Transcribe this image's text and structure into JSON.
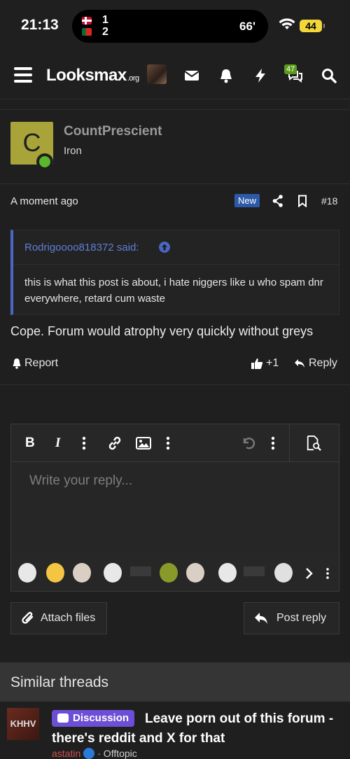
{
  "status_bar": {
    "time": "21:13",
    "score_home": "1",
    "score_away": "2",
    "match_minute": "66'",
    "battery": "44"
  },
  "header": {
    "logo": "Looksmax",
    "logo_suffix": ".org",
    "alerts_badge": "47"
  },
  "post": {
    "avatar_letter": "C",
    "username": "CountPrescient",
    "user_title": "Iron",
    "date": "A moment ago",
    "new_badge": "New",
    "post_number": "#18",
    "quote": {
      "author": "Rodrigoooo818372 said:",
      "text": "this is what this post is about, i hate niggers like u who spam dnr everywhere, retard cum waste"
    },
    "body": "Cope. Forum would atrophy very quickly without greys",
    "report_label": "Report",
    "like_count": "+1",
    "reply_label": "Reply"
  },
  "editor": {
    "placeholder": "Write your reply...",
    "bold": "B",
    "italic": "I"
  },
  "buttons": {
    "attach": "Attach files",
    "post_reply": "Post reply"
  },
  "similar": {
    "heading": "Similar threads",
    "thread": {
      "thumb_text": "KHHV",
      "prefix": "Discussion",
      "title": "Leave porn out of this forum - there's reddit and X for that",
      "author": "astatin",
      "forum": "· Offtopic"
    }
  },
  "colors": {
    "background": "#1f1f1f",
    "accent_blue": "#4a67c4",
    "online_green": "#5ab82c",
    "prefix_purple": "#6c4fd6"
  }
}
